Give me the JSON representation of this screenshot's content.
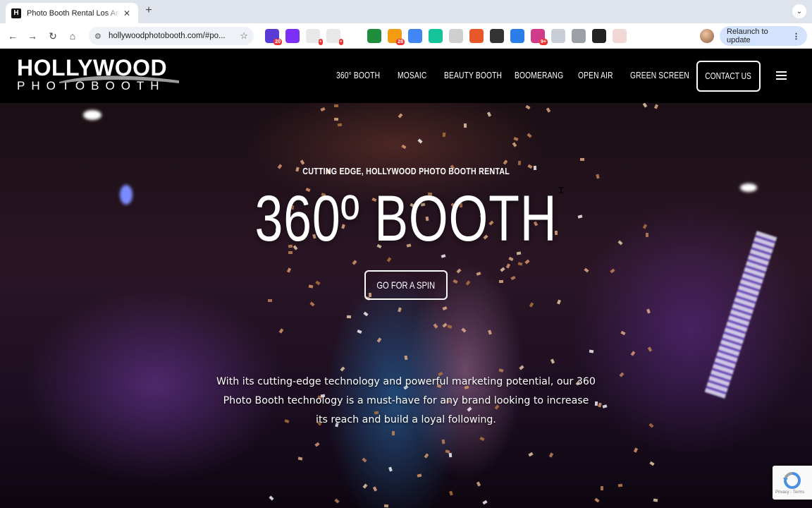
{
  "browser": {
    "tab_title": "Photo Booth Rental Los Angeles",
    "tab_favicon": "H",
    "tab_close": "✕",
    "new_tab": "+",
    "url": "hollywoodphotobooth.com/#po...",
    "relaunch_label": "Relaunch to update",
    "extensions": [
      {
        "icon": "calendar-extension-icon",
        "color": "#5b3bd6",
        "badge": "20"
      },
      {
        "icon": "s-extension-icon",
        "color": "#7b2ff7",
        "badge": ""
      },
      {
        "icon": "slack-extension-icon",
        "color": "#e8e8e8",
        "badge": "•"
      },
      {
        "icon": "square-extension-icon",
        "color": "#e8e8e8",
        "badge": "•"
      },
      {
        "icon": "drive-extension-icon",
        "color": "#ffffff",
        "badge": ""
      },
      {
        "icon": "sheets-extension-icon",
        "color": "#1e8e3e",
        "badge": ""
      },
      {
        "icon": "honey-extension-icon",
        "color": "#f39c12",
        "badge": "28"
      },
      {
        "icon": "translate-extension-icon",
        "color": "#4285f4",
        "badge": ""
      },
      {
        "icon": "grammarly-extension-icon",
        "color": "#15c39a",
        "badge": ""
      },
      {
        "icon": "mail-extension-icon",
        "color": "#cfcfcf",
        "badge": ""
      },
      {
        "icon": "arrow-extension-icon",
        "color": "#e8572a",
        "badge": ""
      },
      {
        "icon": "terminal-extension-icon",
        "color": "#333333",
        "badge": ""
      },
      {
        "icon": "pen-extension-icon",
        "color": "#2b7de9",
        "badge": ""
      },
      {
        "icon": "colorful-extension-icon",
        "color": "#d13b8c",
        "badge": "9+"
      },
      {
        "icon": "shield-extension-icon",
        "color": "#c9ced6",
        "badge": ""
      },
      {
        "icon": "circle-extension-icon",
        "color": "#9aa0a6",
        "badge": ""
      },
      {
        "icon": "send-extension-icon",
        "color": "#222222",
        "badge": ""
      },
      {
        "icon": "pdf-extension-icon",
        "color": "#f2d7d7",
        "badge": ""
      },
      {
        "icon": "puzzle-extension-icon",
        "color": "#ffffff",
        "badge": ""
      },
      {
        "icon": "media-extension-icon",
        "color": "#ffffff",
        "badge": ""
      },
      {
        "icon": "sidepanel-extension-icon",
        "color": "#ffffff",
        "badge": ""
      }
    ]
  },
  "site": {
    "logo_top": "HOLLYWOOD",
    "logo_bottom": "PHOTOBOOTH",
    "nav": [
      {
        "label": "360° BOOTH",
        "left": 0
      },
      {
        "label": "MOSAIC",
        "left": 0
      },
      {
        "label": "BEAUTY BOOTH",
        "left": 0
      },
      {
        "label": "BOOMERANG",
        "left": 0
      },
      {
        "label": "OPEN AIR",
        "left": 0
      },
      {
        "label": "GREEN SCREEN",
        "left": 0
      }
    ],
    "contact_label": "CONTACT US"
  },
  "hero": {
    "sub_heading": "CUTTING EDGE, HOLLYWOOD PHOTO BOOTH RENTAL",
    "heading": "360º BOOTH",
    "cta_label": "GO FOR A SPIN",
    "description": "With its cutting-edge technology and powerful marketing potential, our 360 Photo Booth technology is a must-have for any brand looking to increase its reach and build a loyal following.",
    "recaptcha_text": "Privacy - Terms"
  },
  "colors": {
    "header_bg": "#000000",
    "chrome_tabbar": "#dfe3eb",
    "relaunch_bg": "#d3e3fd"
  }
}
